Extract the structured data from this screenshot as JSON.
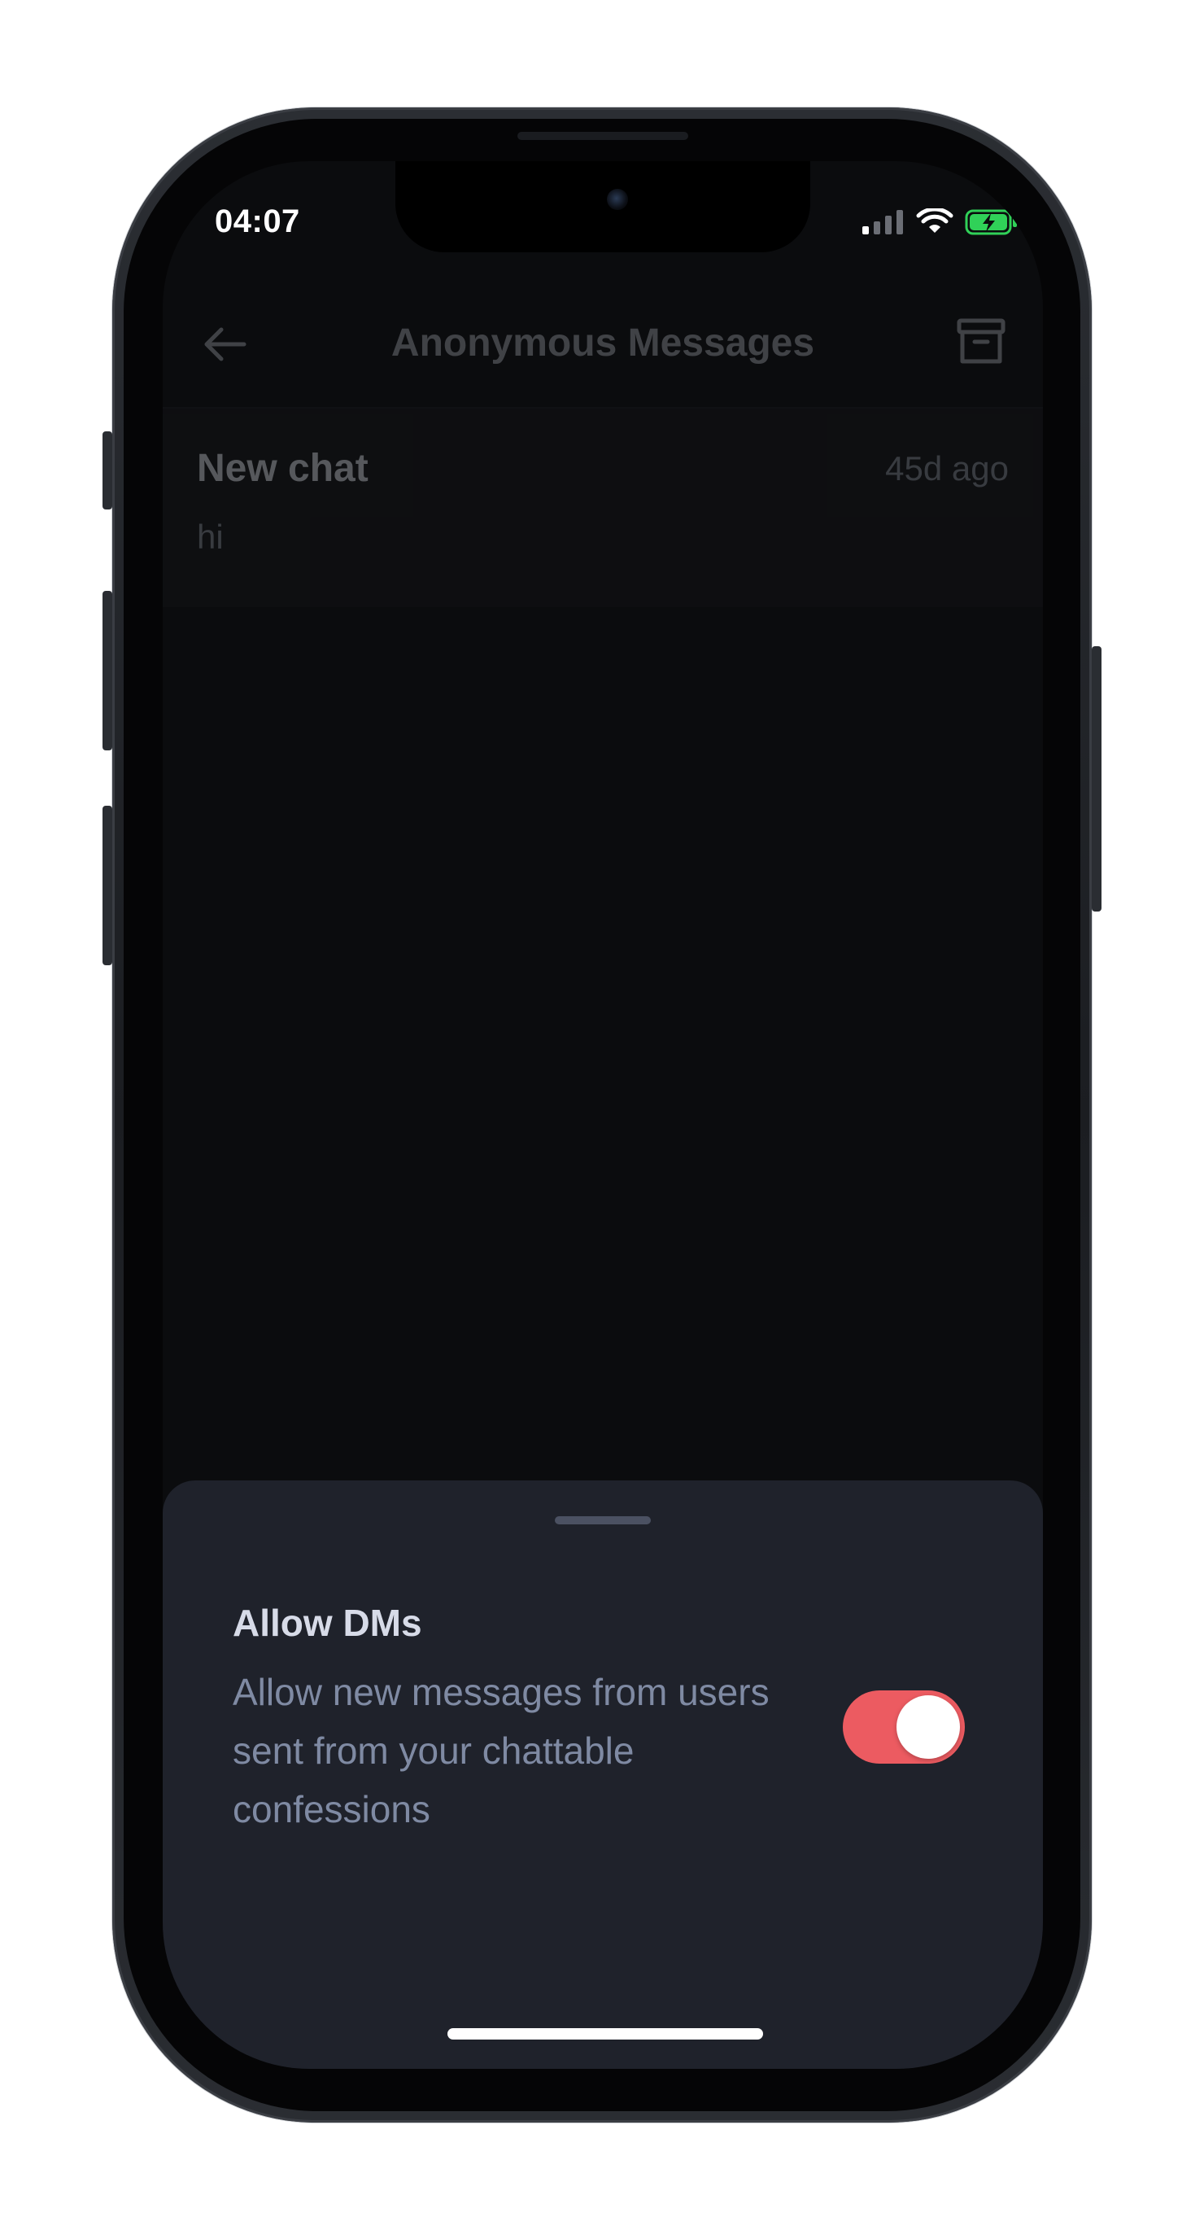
{
  "status_bar": {
    "time": "04:07",
    "signal_icon": "cellular-signal-icon",
    "wifi_icon": "wifi-icon",
    "battery_icon": "battery-charging-icon",
    "battery_color": "#30d158"
  },
  "header": {
    "title": "Anonymous Messages",
    "back_icon": "arrow-left-icon",
    "archive_icon": "archive-icon"
  },
  "chats": [
    {
      "title": "New chat",
      "time": "45d ago",
      "preview": "hi"
    }
  ],
  "sheet": {
    "setting_title": "Allow DMs",
    "setting_description": "Allow new messages from users sent from your chattable confessions",
    "toggle_on": true,
    "toggle_color": "#ec5b61"
  }
}
